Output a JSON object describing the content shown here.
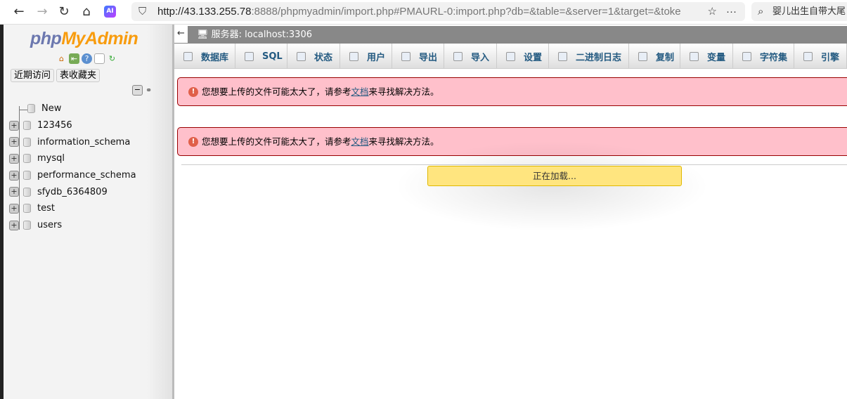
{
  "browser": {
    "url_host": "http://43.133.255.78",
    "url_rest": ":8888/phpmyadmin/import.php#PMAURL-0:import.php?db=&table=&server=1&target=&toke",
    "search_text": "婴儿出生自带大尾",
    "ai_label": "AI"
  },
  "sidebar": {
    "logo_php": "php",
    "logo_myadmin": "MyAdmin",
    "recent_label": "近期访问",
    "favorites_label": "表收藏夹",
    "databases": [
      {
        "name": "New"
      },
      {
        "name": "123456"
      },
      {
        "name": "information_schema"
      },
      {
        "name": "mysql"
      },
      {
        "name": "performance_schema"
      },
      {
        "name": "sfydb_6364809"
      },
      {
        "name": "test"
      },
      {
        "name": "users"
      }
    ]
  },
  "server_bar": {
    "back": "←",
    "title": "服务器: localhost:3306"
  },
  "tabs": [
    {
      "label": "数据库"
    },
    {
      "label": "SQL"
    },
    {
      "label": "状态"
    },
    {
      "label": "用户"
    },
    {
      "label": "导出"
    },
    {
      "label": "导入"
    },
    {
      "label": "设置"
    },
    {
      "label": "二进制日志"
    },
    {
      "label": "复制"
    },
    {
      "label": "变量"
    },
    {
      "label": "字符集"
    },
    {
      "label": "引擎"
    }
  ],
  "messages": [
    {
      "before": "您想要上传的文件可能太大了，请参考",
      "link": "文档",
      "after": "来寻找解决方法。"
    },
    {
      "before": "您想要上传的文件可能太大了，请参考",
      "link": "文档",
      "after": "来寻找解决方法。"
    }
  ],
  "loading": "正在加载..."
}
